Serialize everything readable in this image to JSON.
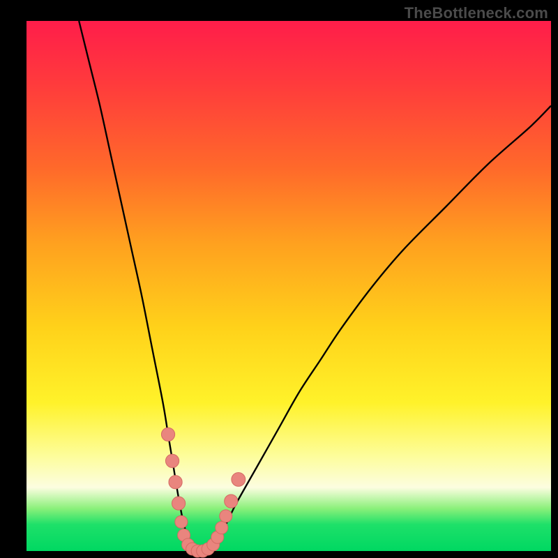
{
  "watermark": "TheBottleneck.com",
  "colors": {
    "background": "#000000",
    "gradient_stops": [
      {
        "pos": 0.0,
        "hex": "#ff1d4a"
      },
      {
        "pos": 0.12,
        "hex": "#ff3b3c"
      },
      {
        "pos": 0.28,
        "hex": "#ff6a2a"
      },
      {
        "pos": 0.42,
        "hex": "#ffa11f"
      },
      {
        "pos": 0.58,
        "hex": "#ffd21a"
      },
      {
        "pos": 0.72,
        "hex": "#fff22a"
      },
      {
        "pos": 0.82,
        "hex": "#fdfd9a"
      },
      {
        "pos": 0.88,
        "hex": "#fcfde0"
      },
      {
        "pos": 0.92,
        "hex": "#8af07a"
      },
      {
        "pos": 0.95,
        "hex": "#1ee069"
      },
      {
        "pos": 1.0,
        "hex": "#00d862"
      }
    ],
    "curve_stroke": "#000000",
    "marker_fill": "#e9857e",
    "marker_stroke": "#d46a63"
  },
  "chart_data": {
    "type": "line",
    "title": "",
    "xlabel": "",
    "ylabel": "",
    "xlim": [
      0,
      100
    ],
    "ylim": [
      0,
      100
    ],
    "series": [
      {
        "name": "left-branch",
        "x": [
          10,
          12,
          14,
          16,
          18,
          20,
          22,
          24,
          26,
          27,
          28,
          29,
          30,
          31,
          32,
          33
        ],
        "y": [
          100,
          92,
          84,
          75,
          66,
          57,
          48,
          38,
          28,
          22,
          16,
          10,
          5,
          2,
          0,
          0
        ]
      },
      {
        "name": "right-branch",
        "x": [
          33,
          34,
          36,
          38,
          40,
          44,
          48,
          52,
          56,
          60,
          66,
          72,
          80,
          88,
          96,
          100
        ],
        "y": [
          0,
          0,
          2,
          5,
          9,
          16,
          23,
          30,
          36,
          42,
          50,
          57,
          65,
          73,
          80,
          84
        ]
      }
    ],
    "markers": [
      {
        "x": 27.0,
        "y": 22.0,
        "r": 1.5
      },
      {
        "x": 27.8,
        "y": 17.0,
        "r": 1.5
      },
      {
        "x": 28.4,
        "y": 13.0,
        "r": 1.5
      },
      {
        "x": 29.0,
        "y": 9.0,
        "r": 1.5
      },
      {
        "x": 29.5,
        "y": 5.5,
        "r": 1.3
      },
      {
        "x": 30.0,
        "y": 3.0,
        "r": 1.3
      },
      {
        "x": 30.8,
        "y": 1.2,
        "r": 1.3
      },
      {
        "x": 31.6,
        "y": 0.4,
        "r": 1.3
      },
      {
        "x": 32.6,
        "y": 0.0,
        "r": 1.3
      },
      {
        "x": 33.6,
        "y": 0.0,
        "r": 1.3
      },
      {
        "x": 34.6,
        "y": 0.4,
        "r": 1.3
      },
      {
        "x": 35.6,
        "y": 1.2,
        "r": 1.3
      },
      {
        "x": 36.4,
        "y": 2.6,
        "r": 1.3
      },
      {
        "x": 37.2,
        "y": 4.4,
        "r": 1.3
      },
      {
        "x": 38.0,
        "y": 6.6,
        "r": 1.3
      },
      {
        "x": 39.0,
        "y": 9.4,
        "r": 1.5
      },
      {
        "x": 40.4,
        "y": 13.5,
        "r": 1.6
      }
    ]
  }
}
